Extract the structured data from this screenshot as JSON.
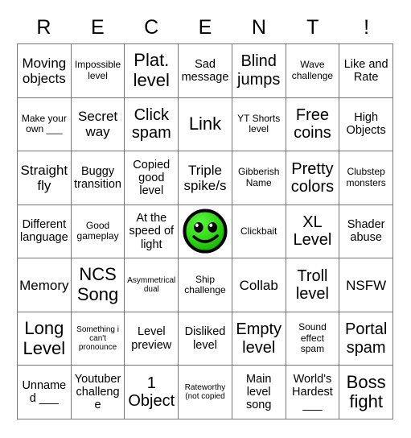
{
  "card": {
    "header_letters": [
      "R",
      "E",
      "C",
      "E",
      "N",
      "T",
      "!"
    ],
    "grid_size": 7,
    "free_space": {
      "row": 4,
      "col": 4,
      "icon": "geometry-dash-cube-face-icon",
      "colors": {
        "face_light": "#5cf542",
        "face_mid": "#2fd616",
        "face_dark": "#14a800",
        "outline": "#000000",
        "eye_white": "#ffffff",
        "eye_black": "#000000"
      }
    },
    "colors": {
      "background": "#ffffff",
      "grid_line": "#777777",
      "text": "#000000"
    },
    "rows": [
      [
        {
          "text": "Moving objects",
          "size": "lg"
        },
        {
          "text": "Impossible level",
          "size": "sm"
        },
        {
          "text": "Plat. level",
          "size": "xxl"
        },
        {
          "text": "Sad message",
          "size": "md"
        },
        {
          "text": "Blind jumps",
          "size": "xl"
        },
        {
          "text": "Wave challenge",
          "size": "sm"
        },
        {
          "text": "Like and Rate",
          "size": "md"
        }
      ],
      [
        {
          "text": "Make your own ___",
          "size": "sm"
        },
        {
          "text": "Secret way",
          "size": "lg"
        },
        {
          "text": "Click spam",
          "size": "xl"
        },
        {
          "text": "Link",
          "size": "xxl"
        },
        {
          "text": "YT Shorts level",
          "size": "sm"
        },
        {
          "text": "Free coins",
          "size": "xl"
        },
        {
          "text": "High Objects",
          "size": "md"
        }
      ],
      [
        {
          "text": "Straight fly",
          "size": "lg"
        },
        {
          "text": "Buggy transition",
          "size": "md"
        },
        {
          "text": "Copied good level",
          "size": "md"
        },
        {
          "text": "Triple spike/s",
          "size": "lg"
        },
        {
          "text": "Gibberish Name",
          "size": "sm"
        },
        {
          "text": "Pretty colors",
          "size": "xl"
        },
        {
          "text": "Clubstep monsters",
          "size": "sm"
        }
      ],
      [
        {
          "text": "Different language",
          "size": "md"
        },
        {
          "text": "Good gameplay",
          "size": "sm"
        },
        {
          "text": "At the speed of light",
          "size": "md"
        },
        {
          "text": "",
          "size": "md",
          "free": true
        },
        {
          "text": "Clickbait",
          "size": "sm"
        },
        {
          "text": "XL Level",
          "size": "xl"
        },
        {
          "text": "Shader abuse",
          "size": "md"
        }
      ],
      [
        {
          "text": "Memory",
          "size": "lg"
        },
        {
          "text": "NCS Song",
          "size": "xxl"
        },
        {
          "text": "Asymmetrical dual",
          "size": "xs"
        },
        {
          "text": "Ship challenge",
          "size": "sm"
        },
        {
          "text": "Collab",
          "size": "lg"
        },
        {
          "text": "Troll level",
          "size": "xl"
        },
        {
          "text": "NSFW",
          "size": "lg"
        }
      ],
      [
        {
          "text": "Long Level",
          "size": "xxl"
        },
        {
          "text": "Something i can't pronounce",
          "size": "xs"
        },
        {
          "text": "Level preview",
          "size": "md"
        },
        {
          "text": "Disliked level",
          "size": "md"
        },
        {
          "text": "Empty level",
          "size": "xl"
        },
        {
          "text": "Sound effect spam",
          "size": "sm"
        },
        {
          "text": "Portal spam",
          "size": "xl"
        }
      ],
      [
        {
          "text": "Unnamed ___",
          "size": "md"
        },
        {
          "text": "Youtuber challenge",
          "size": "md"
        },
        {
          "text": "1 Object",
          "size": "xl"
        },
        {
          "text": "Rateworthy (not copied",
          "size": "xs"
        },
        {
          "text": "Main level song",
          "size": "md"
        },
        {
          "text": "World's Hardest ___",
          "size": "md"
        },
        {
          "text": "Boss fight",
          "size": "xxl"
        }
      ]
    ]
  }
}
